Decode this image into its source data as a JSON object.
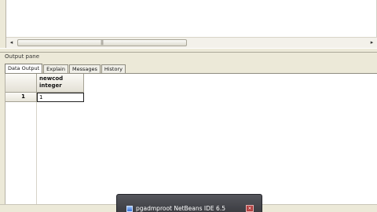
{
  "top_area": {
    "scrollbar": {
      "left_arrow": "◂",
      "right_arrow": "▸",
      "grip": "|||"
    }
  },
  "output_pane": {
    "title": "Output pane",
    "tabs": [
      {
        "label": "Data Output",
        "active": true
      },
      {
        "label": "Explain",
        "active": false
      },
      {
        "label": "Messages",
        "active": false
      },
      {
        "label": "History",
        "active": false
      }
    ],
    "grid": {
      "columns": [
        {
          "name": "newcod",
          "type": "integer"
        }
      ],
      "rows": [
        {
          "row_number": "1",
          "values": [
            "1"
          ]
        }
      ]
    }
  },
  "status_bar": {
    "text": ""
  },
  "taskbar_popup": {
    "text": "pgadmproot   NetBeans IDE 6.5",
    "close_glyph": "×"
  },
  "colors": {
    "background": "#ece9d8",
    "popup_background": "#45464b",
    "close_button": "#b24040"
  }
}
